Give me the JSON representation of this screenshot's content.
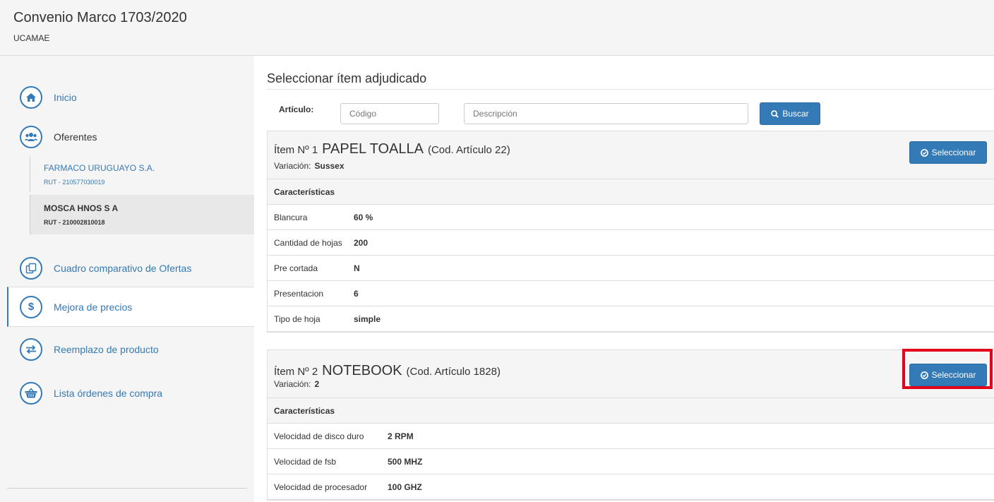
{
  "header": {
    "title": "Convenio Marco 1703/2020",
    "subtitle": "UCAMAE"
  },
  "sidebar": {
    "items": [
      {
        "label": "Inicio",
        "icon": "home-icon"
      },
      {
        "label": "Oferentes",
        "icon": "users-icon"
      },
      {
        "label": "Cuadro comparativo de Ofertas",
        "icon": "copy-icon"
      },
      {
        "label": "Mejora de precios",
        "icon": "dollar-icon"
      },
      {
        "label": "Reemplazo de producto",
        "icon": "exchange-icon"
      },
      {
        "label": "Lista órdenes de compra",
        "icon": "basket-icon"
      }
    ],
    "oferentes": [
      {
        "name": "FARMACO URUGUAYO S.A.",
        "rut": "RUT - 210577030019"
      },
      {
        "name": "MOSCA HNOS S A",
        "rut": "RUT - 210002810018"
      }
    ]
  },
  "main": {
    "section_title": "Seleccionar ítem adjudicado",
    "search": {
      "label": "Artículo:",
      "code_placeholder": "Código",
      "desc_placeholder": "Descripción",
      "button": "Buscar"
    },
    "select_label": "Seleccionar",
    "characteristics_label": "Características",
    "variation_label": "Variación:",
    "items": [
      {
        "number": "Ítem Nº 1",
        "name": "PAPEL TOALLA",
        "code": "(Cod. Artículo 22)",
        "variation": "Sussex",
        "rows": [
          {
            "key": "Blancura",
            "value": "60 %"
          },
          {
            "key": "Cantidad de hojas",
            "value": "200"
          },
          {
            "key": "Pre cortada",
            "value": "N"
          },
          {
            "key": "Presentacion",
            "value": "6"
          },
          {
            "key": "Tipo de hoja",
            "value": "simple"
          }
        ]
      },
      {
        "number": "Ítem Nº 2",
        "name": "NOTEBOOK",
        "code": "(Cod. Artículo 1828)",
        "variation": "2",
        "rows": [
          {
            "key": "Velocidad de disco duro",
            "value": "2 RPM"
          },
          {
            "key": "Velocidad de fsb",
            "value": "500 MHZ"
          },
          {
            "key": "Velocidad de procesador",
            "value": "100 GHZ"
          }
        ]
      }
    ]
  },
  "colors": {
    "primary": "#337ab7",
    "highlight": "#e3001b",
    "panel": "#f5f5f5"
  }
}
